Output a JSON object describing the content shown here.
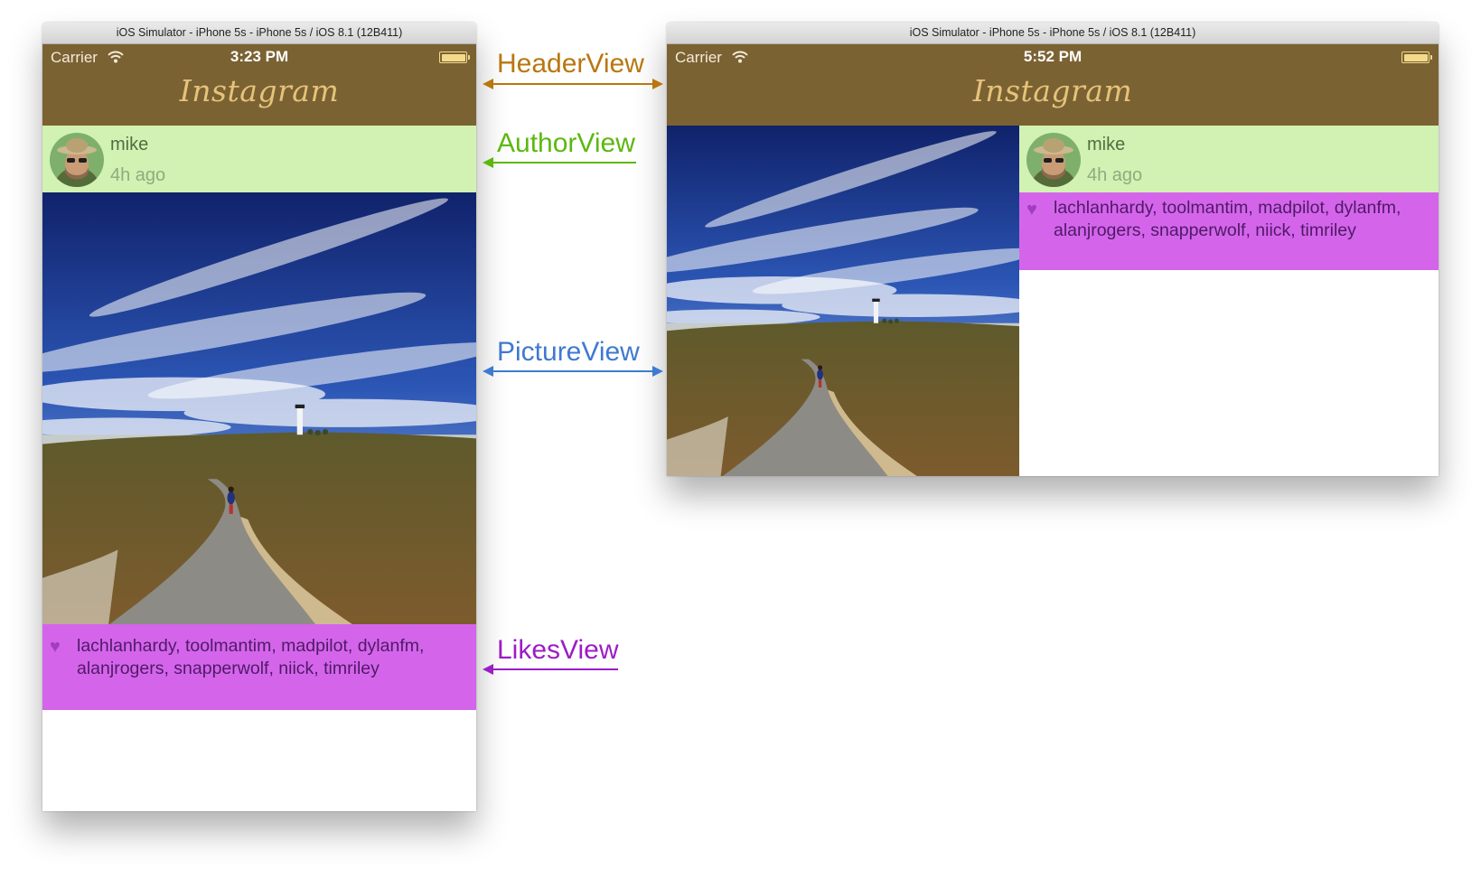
{
  "left_window": {
    "title": "iOS Simulator - iPhone 5s - iPhone 5s / iOS 8.1 (12B411)",
    "status": {
      "carrier": "Carrier",
      "time": "3:23 PM"
    },
    "header": {
      "brand": "Instagram"
    },
    "author": {
      "name": "mike",
      "time": "4h ago"
    },
    "likes": {
      "text": "lachlanhardy, toolmantim, madpilot, dylanfm, alanjrogers, snapperwolf, niick, timriley"
    }
  },
  "right_window": {
    "title": "iOS Simulator - iPhone 5s - iPhone 5s / iOS 8.1 (12B411)",
    "status": {
      "carrier": "Carrier",
      "time": "5:52 PM"
    },
    "header": {
      "brand": "Instagram"
    },
    "author": {
      "name": "mike",
      "time": "4h ago"
    },
    "likes": {
      "text": "lachlanhardy, toolmantim, madpilot, dylanfm, alanjrogers, snapperwolf, niick, timriley"
    }
  },
  "annotations": [
    {
      "label": "HeaderView",
      "color": "#b8770f",
      "arrow": "double"
    },
    {
      "label": "AuthorView",
      "color": "#5cb80f",
      "arrow": "left"
    },
    {
      "label": "PictureView",
      "color": "#3f7ad0",
      "arrow": "double"
    },
    {
      "label": "LikesView",
      "color": "#9b1dc6",
      "arrow": "left"
    }
  ],
  "icons": {
    "wifi": "wifi-icon",
    "battery": "battery-icon",
    "heart": "heart-icon"
  },
  "colors": {
    "header_bg": "#7b6233",
    "author_bg": "#d1f2b2",
    "likes_bg": "#d465eb"
  }
}
